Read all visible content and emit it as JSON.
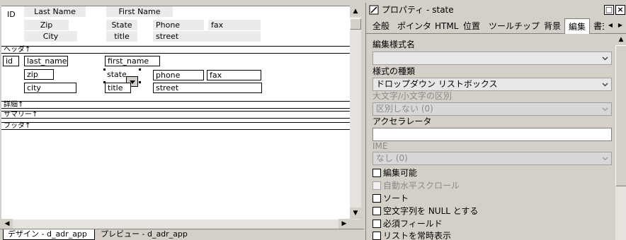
{
  "design": {
    "header_texts": {
      "id": "ID",
      "last_name": "Last Name",
      "first_name": "First Name",
      "zip": "Zip",
      "state": "State",
      "phone": "Phone",
      "fax": "fax",
      "city": "City",
      "title": "title",
      "street": "street"
    },
    "bands": {
      "header": "ヘッダ↑",
      "detail": "詳細↑",
      "summary": "サマリー↑",
      "footer": "フッタ↑"
    },
    "columns": {
      "id": "id",
      "last_name": "last_name",
      "first_name": "first_name",
      "zip": "zip",
      "state": "state",
      "phone": "phone",
      "fax": "fax",
      "city": "city",
      "title": "title",
      "street": "street"
    },
    "tabs": {
      "design": "デザイン - d_adr_app",
      "preview": "プレビュー - d_adr_app"
    }
  },
  "properties": {
    "title": "プロパティ - state",
    "tabs": [
      "全般",
      "ポインタ",
      "HTML",
      "位置",
      "ツールチップ",
      "背景",
      "編集",
      "書式"
    ],
    "active_tab": "編集",
    "fields": {
      "edit_style_name_label": "編集様式名",
      "edit_style_name_value": "",
      "style_type_label": "様式の種類",
      "style_type_value": "ドロップダウン リストボックス",
      "case_label": "大文字/小文字の区別",
      "case_value": "区別しない (0)",
      "accelerator_label": "アクセラレータ",
      "accelerator_value": "",
      "ime_label": "IME",
      "ime_value": "なし (0)"
    },
    "checkboxes": [
      {
        "label": "編集可能",
        "checked": false,
        "enabled": true
      },
      {
        "label": "自動水平スクロール",
        "checked": false,
        "enabled": false
      },
      {
        "label": "ソート",
        "checked": false,
        "enabled": true
      },
      {
        "label": "空文字列を NULL とする",
        "checked": false,
        "enabled": true
      },
      {
        "label": "必須フィールド",
        "checked": false,
        "enabled": true
      },
      {
        "label": "リストを常時表示",
        "checked": false,
        "enabled": true
      }
    ]
  }
}
